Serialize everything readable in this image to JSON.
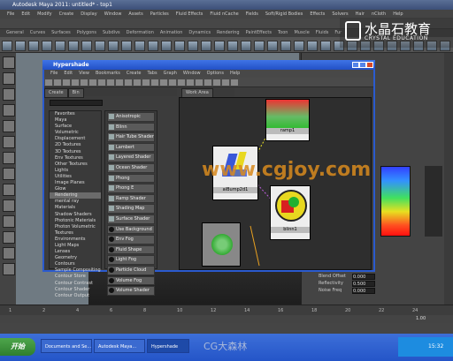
{
  "maya": {
    "title": "Autodesk Maya 2011: untitled*   - top1",
    "menu": [
      "File",
      "Edit",
      "Modify",
      "Create",
      "Display",
      "Window",
      "Assets",
      "Particles",
      "Fluid Effects",
      "Fluid nCache",
      "Fields",
      "Soft/Rigid Bodies",
      "Effects",
      "Solvers",
      "Hair",
      "nCloth",
      "Help"
    ],
    "shelf_tabs": [
      "General",
      "Curves",
      "Surfaces",
      "Polygons",
      "Subdivs",
      "Deformation",
      "Animation",
      "Dynamics",
      "Rendering",
      "PaintEffects",
      "Toon",
      "Muscle",
      "Fluids",
      "Fur"
    ],
    "viewport_menu": [
      "View",
      "Shading",
      "Lighting",
      "Show",
      "Renderer",
      "Panels"
    ],
    "attrs": [
      {
        "label": "Blend Offset",
        "value": "0.000"
      },
      {
        "label": "Reflectivity",
        "value": "0.500"
      },
      {
        "label": "Noise Freq",
        "value": "0.000"
      }
    ],
    "timeline_ticks": [
      "1",
      "2",
      "4",
      "6",
      "8",
      "10",
      "12",
      "14",
      "16",
      "18",
      "20",
      "22",
      "24"
    ],
    "current_frame": "1.00"
  },
  "hypershade": {
    "title": "Hypershade",
    "menu": [
      "File",
      "Edit",
      "View",
      "Bookmarks",
      "Create",
      "Tabs",
      "Graph",
      "Window",
      "Options",
      "Help"
    ],
    "tabs": [
      "Create",
      "Bin"
    ],
    "work_tabs": [
      "Work Area"
    ],
    "tree": [
      "Favorites",
      "Maya",
      "Surface",
      "Volumetric",
      "Displacement",
      "2D Textures",
      "3D Textures",
      "Env Textures",
      "Other Textures",
      "Lights",
      "Utilities",
      "Image Planes",
      "Glow",
      "Rendering",
      "mental ray",
      "Materials",
      "Shadow Shaders",
      "Photonic Materials",
      "Photon Volumetric",
      "Textures",
      "Environments",
      "Light Maps",
      "Lenses",
      "Geometry",
      "Contours",
      "Sample Compositing",
      "Contour Store",
      "Contour Contrast",
      "Contour Shader",
      "Contour Output"
    ],
    "tree_selected": "Rendering",
    "create_items": [
      "Anisotropic",
      "Blinn",
      "Hair Tube Shader",
      "Lambert",
      "Layered Shader",
      "Ocean Shader",
      "Phong",
      "Phong E",
      "Ramp Shader",
      "Shading Map",
      "Surface Shader",
      "Use Background",
      "Env Fog",
      "Fluid Shape",
      "Light Fog",
      "Particle Cloud",
      "Volume Fog",
      "Volume Shader"
    ],
    "nodes": [
      {
        "label": "ramp1"
      },
      {
        "label": "aiBump2d1"
      },
      {
        "label": "blinn1"
      }
    ]
  },
  "watermark": {
    "url": "www.cgjoy.com",
    "bottom": "CG大森林"
  },
  "logo": {
    "cn": "水晶石教育",
    "en": "CRYSTAL EDUCATION"
  },
  "taskbar": {
    "start": "开始",
    "items": [
      "Documents and Se...",
      "Autodesk Maya...",
      "Hypershade"
    ],
    "clock": "15:32"
  }
}
